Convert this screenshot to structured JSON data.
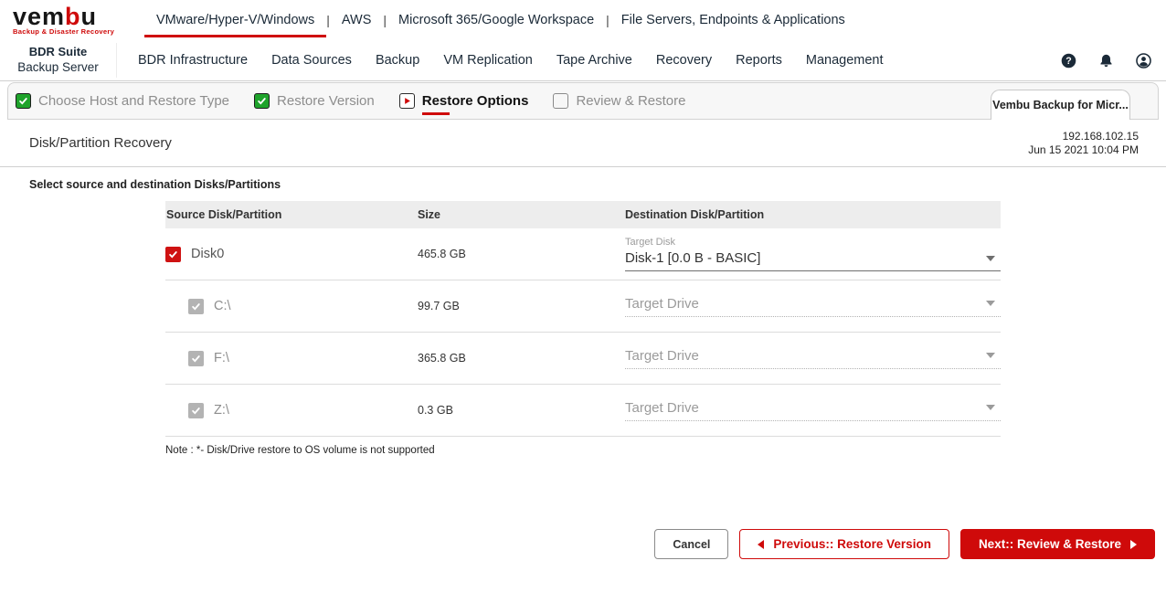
{
  "brand": {
    "wordmark_prefix": "vem",
    "wordmark_accent": "b",
    "wordmark_suffix": "u",
    "tagline": "Backup & Disaster Recovery"
  },
  "product_nav": {
    "items": [
      {
        "label": "VMware/Hyper-V/Windows",
        "active": true
      },
      {
        "label": "AWS",
        "active": false
      },
      {
        "label": "Microsoft 365/Google Workspace",
        "active": false
      },
      {
        "label": "File Servers, Endpoints & Applications",
        "active": false
      }
    ]
  },
  "app_bar": {
    "suite_title": "BDR Suite",
    "suite_subtitle": "Backup Server",
    "menu": [
      "BDR Infrastructure",
      "Data Sources",
      "Backup",
      "VM Replication",
      "Tape Archive",
      "Recovery",
      "Reports",
      "Management"
    ],
    "icons": [
      "help-icon",
      "notifications-icon",
      "account-icon"
    ]
  },
  "wizard": {
    "steps": [
      {
        "label": "Choose Host and Restore Type",
        "state": "done"
      },
      {
        "label": "Restore Version",
        "state": "done"
      },
      {
        "label": "Restore Options",
        "state": "active"
      },
      {
        "label": "Review & Restore",
        "state": "todo"
      }
    ],
    "context_tab": "Vembu Backup for Micr..."
  },
  "page": {
    "title": "Disk/Partition Recovery",
    "host_ip": "192.168.102.15",
    "timestamp": "Jun 15 2021 10:04 PM",
    "section_heading": "Select source and destination Disks/Partitions",
    "note": "Note : *- Disk/Drive restore to OS volume is not supported"
  },
  "table": {
    "headers": [
      "Source Disk/Partition",
      "Size",
      "Destination Disk/Partition"
    ],
    "rows": [
      {
        "name": "Disk0",
        "size": "465.8 GB",
        "checked": true,
        "enabled": true,
        "target_label": "Target Disk",
        "target_value": "Disk-1 [0.0 B - BASIC]"
      },
      {
        "name": "C:\\",
        "size": "99.7 GB",
        "checked": true,
        "enabled": false,
        "target_value": "Target Drive"
      },
      {
        "name": "F:\\",
        "size": "365.8 GB",
        "checked": true,
        "enabled": false,
        "target_value": "Target Drive"
      },
      {
        "name": "Z:\\",
        "size": "0.3 GB",
        "checked": true,
        "enabled": false,
        "target_value": "Target Drive"
      }
    ]
  },
  "footer": {
    "cancel_label": "Cancel",
    "previous_label": "Previous:: Restore Version",
    "next_label": "Next:: Review & Restore"
  },
  "colors": {
    "accent_red": "#cf0a0a",
    "done_green": "#1fa32b",
    "text_dark": "#1b2a38"
  }
}
